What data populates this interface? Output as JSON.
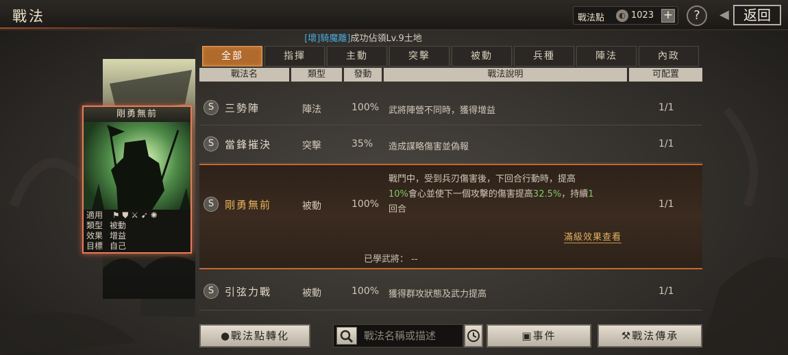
{
  "header": {
    "title": "戰法",
    "points_label": "戰法點",
    "points_value": "1023",
    "add_label": "+",
    "help_label": "?",
    "back_label": "返回"
  },
  "notice": {
    "tag": "[壞]騎魔離]",
    "text": "成功佔領Lv.9土地"
  },
  "tabs": [
    {
      "label": "全部",
      "active": true
    },
    {
      "label": "指揮"
    },
    {
      "label": "主動"
    },
    {
      "label": "突擊"
    },
    {
      "label": "被動"
    },
    {
      "label": "兵種"
    },
    {
      "label": "陣法"
    },
    {
      "label": "內政"
    }
  ],
  "columns": [
    "戰法名",
    "類型",
    "發動",
    "戰法說明",
    "可配置"
  ],
  "rows": [
    {
      "icon": "S",
      "name": "三勢陣",
      "type": "陣法",
      "rate": "100%",
      "desc": "武將陣營不同時，獲得增益",
      "count": "1/1"
    },
    {
      "icon": "S",
      "name": "當鋒摧決",
      "type": "突擊",
      "rate": "35%",
      "desc": "造成謀略傷害並偽報",
      "count": "1/1"
    },
    {
      "icon": "S",
      "name": "剛勇無前",
      "type": "被動",
      "rate": "100%",
      "desc_1": "戰鬥中，受到兵刃傷害後，下回合行動時，提高",
      "desc_2a": "10%",
      "desc_2b": "會心並使下一個攻擊的傷害提高",
      "desc_2c": "32.5%",
      "desc_2d": "，持續",
      "desc_2e": "1",
      "desc_3": "回合",
      "count": "1/1",
      "full_effect": "滿級效果查看",
      "learned": "已學武將：  --"
    },
    {
      "icon": "S",
      "name": "引弦力戰",
      "type": "被動",
      "rate": "100%",
      "desc": "獲得群攻狀態及武力提高",
      "count": "1/1"
    }
  ],
  "card": {
    "title": "剛勇無前",
    "apply_label": "適用",
    "type_label": "類型",
    "type_value": "被動",
    "effect_label": "效果",
    "effect_value": "增益",
    "target_label": "目標",
    "target_value": "自己"
  },
  "buttons": {
    "convert": "戰法點轉化",
    "search_placeholder": "戰法名稱或描述",
    "event": "事件",
    "inherit": "戰法傳承"
  },
  "colors": {
    "accent": "#b06a2c",
    "highlight": "#7ec86a",
    "gold": "#e8b458"
  },
  "icons": {
    "points": "points-coin-icon",
    "search": "search-icon",
    "clock": "clock-icon",
    "convert": "drop-icon",
    "event": "event-book-icon",
    "inherit": "hammer-icon"
  }
}
